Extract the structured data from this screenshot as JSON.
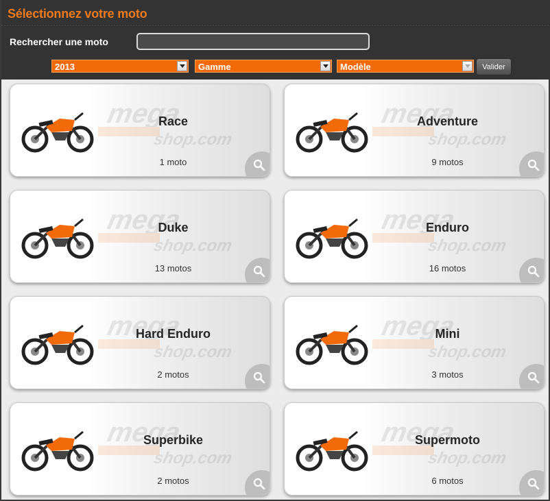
{
  "header": {
    "title": "Sélectionnez votre moto",
    "search_label": "Rechercher une moto",
    "search_value": "",
    "year_select": "2013",
    "range_select": "Gamme",
    "model_select": "Modèle",
    "submit_label": "Valider"
  },
  "colors": {
    "accent": "#f26a0a",
    "header_bg": "#333333",
    "title": "#f07a1a"
  },
  "categories": [
    {
      "name": "Race",
      "count": "1 moto",
      "icon": "sport-bike-icon"
    },
    {
      "name": "Adventure",
      "count": "9 motos",
      "icon": "adventure-bike-icon"
    },
    {
      "name": "Duke",
      "count": "13 motos",
      "icon": "naked-bike-icon"
    },
    {
      "name": "Enduro",
      "count": "16 motos",
      "icon": "enduro-bike-icon"
    },
    {
      "name": "Hard Enduro",
      "count": "2 motos",
      "icon": "hard-enduro-bike-icon"
    },
    {
      "name": "Mini",
      "count": "3 motos",
      "icon": "mini-bike-icon"
    },
    {
      "name": "Superbike",
      "count": "2 motos",
      "icon": "superbike-icon"
    },
    {
      "name": "Supermoto",
      "count": "6 motos",
      "icon": "supermoto-bike-icon"
    }
  ]
}
